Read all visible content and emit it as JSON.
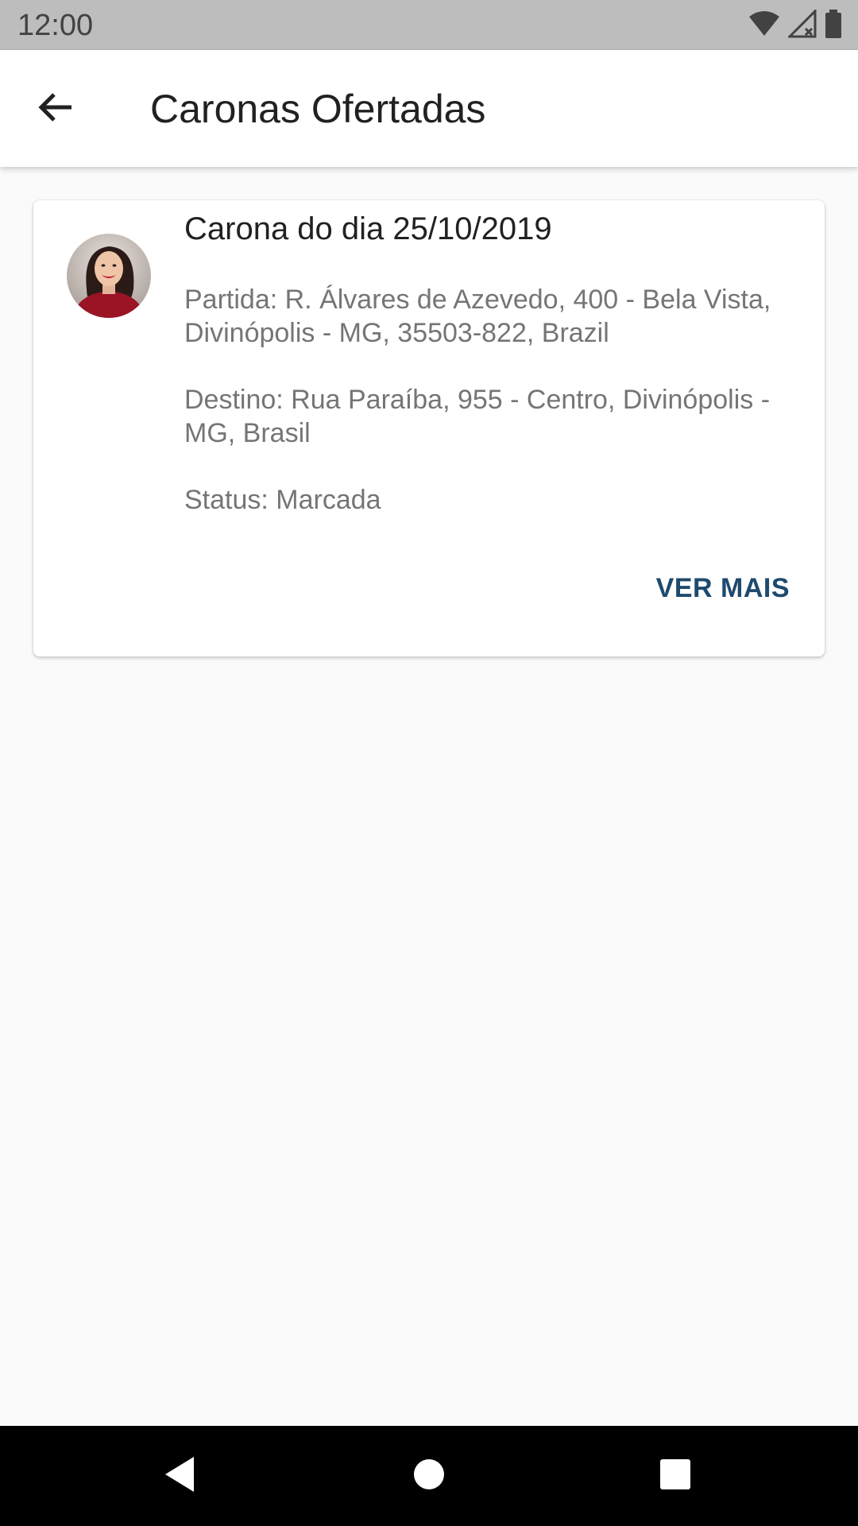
{
  "status_bar": {
    "time": "12:00",
    "icons": [
      "wifi-icon",
      "signal-icon",
      "battery-icon"
    ]
  },
  "app_bar": {
    "title": "Caronas Ofertadas",
    "back_icon": "arrow-back-icon"
  },
  "card": {
    "title": "Carona do dia 25/10/2019",
    "partida": "Partida: R. Álvares de Azevedo, 400 - Bela Vista, Divinópolis - MG, 35503-822, Brazil",
    "destino": "Destino: Rua Paraíba, 955 - Centro, Divinópolis - MG, Brasil",
    "status": "Status: Marcada",
    "action_label": "VER MAIS"
  },
  "nav_bar": {
    "buttons": [
      "back-triangle-icon",
      "home-circle-icon",
      "recents-square-icon"
    ]
  },
  "colors": {
    "status_bar": "#bdbdbd",
    "app_bar": "#ffffff",
    "accent": "#1e4a6e",
    "background": "#fafafa"
  }
}
